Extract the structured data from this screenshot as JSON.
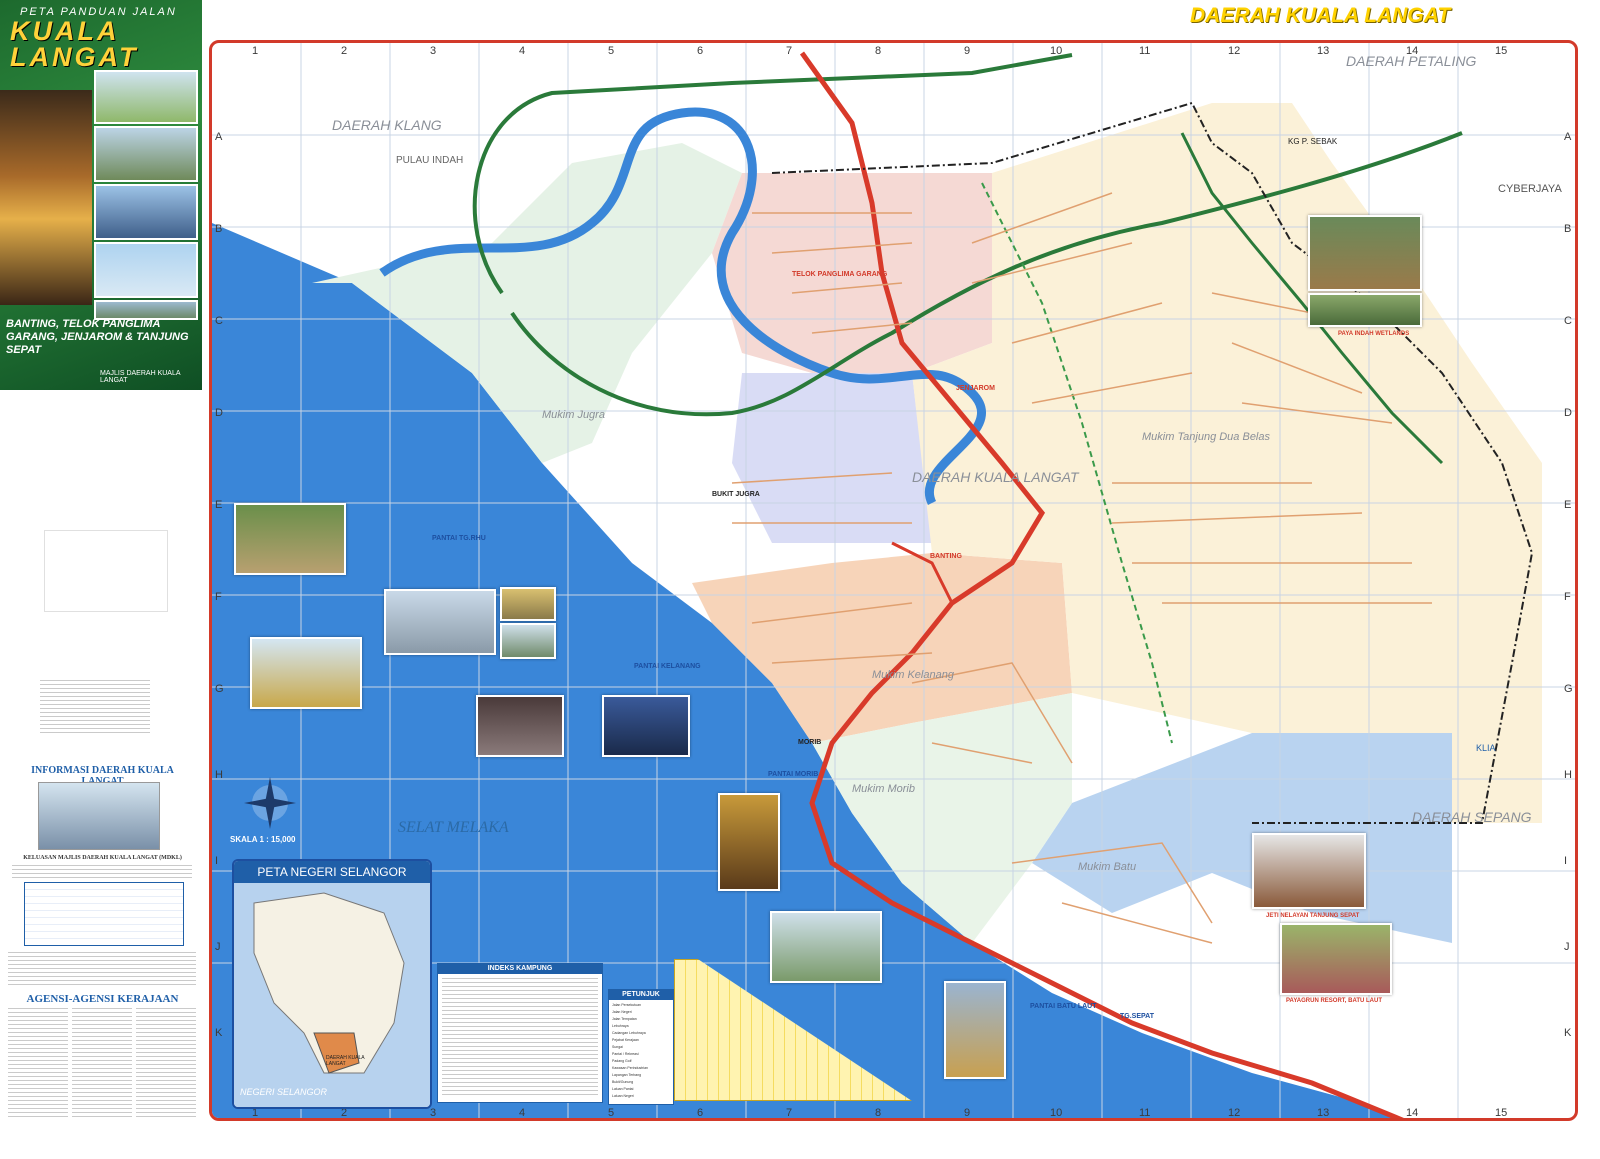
{
  "header": {
    "title": "DAERAH KUALA LANGAT"
  },
  "cover": {
    "top_text": "PETA PANDUAN JALAN",
    "brand": "KUALA LANGAT",
    "places": "BANTING, TELOK PANGLIMA GARANG, JENJAROM & TANJUNG SEPAT",
    "council": "MAJLIS DAERAH KUALA LANGAT"
  },
  "sidebar": {
    "info_title": "INFORMASI DAERAH KUALA LANGAT",
    "info_subtitle": "KELUASAN MAJLIS DAERAH KUALA LANGAT (MDKL)",
    "agencies_title": "AGENSI-AGENSI KERAJAAN"
  },
  "grid": {
    "columns": [
      "1",
      "2",
      "3",
      "4",
      "5",
      "6",
      "7",
      "8",
      "9",
      "10",
      "11",
      "12",
      "13",
      "14",
      "15"
    ],
    "rows": [
      "A",
      "B",
      "C",
      "D",
      "E",
      "F",
      "G",
      "H",
      "I",
      "J",
      "K"
    ]
  },
  "regions": {
    "klang": "DAERAH KLANG",
    "petaling": "DAERAH PETALING",
    "kuala_langat": "DAERAH KUALA LANGAT",
    "sepang": "DAERAH SEPANG",
    "cyberjaya": "CYBERJAYA",
    "selat_melaka": "SELAT MELAKA",
    "mukim_jugra": "Mukim Jugra",
    "mukim_tanjung_dua_belas": "Mukim Tanjung Dua Belas",
    "mukim_kelanang": "Mukim Kelanang",
    "mukim_morib": "Mukim Morib",
    "mukim_batu": "Mukim Batu",
    "pulau_indah": "PULAU INDAH",
    "klia": "KLIA",
    "kg_p_sebak": "KG P. SEBAK"
  },
  "towns": {
    "telok_panglima_garang": "TELOK PANGLIMA GARANG",
    "jenjarom": "JENJAROM",
    "banting": "BANTING",
    "tg_sepat": "TG.SEPAT",
    "bukit_jugra": "BUKIT JUGRA",
    "morib": "MORIB"
  },
  "beaches": {
    "pantai_tg_rhu": "PANTAI TG.RHU",
    "pantai_kelanang": "PANTAI KELANANG",
    "pantai_morib": "PANTAI MORIB",
    "pantai_batu_laut": "PANTAI BATU LAUT"
  },
  "scale": {
    "label": "SKALA 1 : 15,000"
  },
  "inset": {
    "title": "PETA NEGERI SELANGOR",
    "footer": "NEGERI SELANGOR",
    "district": "DAERAH KUALA LANGAT"
  },
  "indeks": {
    "title": "INDEKS KAMPUNG"
  },
  "petunjuk": {
    "title": "PETUNJUK",
    "items": [
      "Jalan Persekutuan",
      "Jalan Negeri",
      "Jalan Tempatan",
      "Lebuhraya",
      "Cadangan Lebuhraya",
      "Pejabat Kerajaan",
      "Sungai",
      "Pantai / Rekreasi",
      "Padang Golf",
      "Kawasan Perindustrian",
      "Lapangan Terbang",
      "Bukit/Gunung",
      "Laluan Pantai",
      "Laluan Negeri"
    ]
  },
  "photo_captions": {
    "jeti": "JETI NELAYAN TANJUNG SEPAT",
    "payagrun": "PAYAGRUN RESORT, BATU LAUT",
    "paya_indah": "PAYA INDAH WETLANDS"
  }
}
